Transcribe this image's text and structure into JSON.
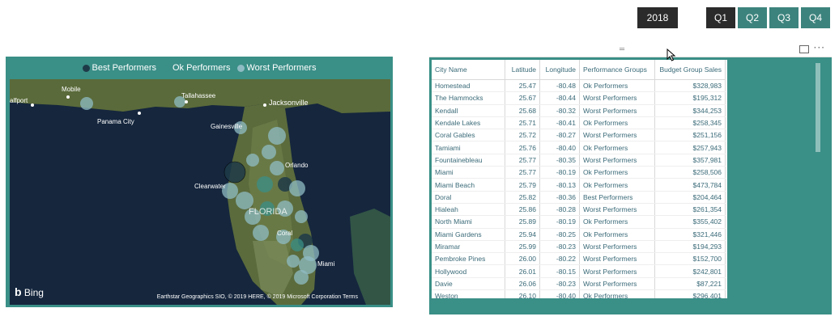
{
  "slicer": {
    "year": "2018",
    "quarters": [
      "Q1",
      "Q2",
      "Q3",
      "Q4"
    ],
    "selected_quarter": "Q1"
  },
  "map": {
    "legend": [
      {
        "label": "Best Performers",
        "color": "#1e3a48"
      },
      {
        "label": "Ok Performers",
        "color": "#3a8f87"
      },
      {
        "label": "Worst Performers",
        "color": "#8fbcc4"
      }
    ],
    "city_labels": [
      "alfport",
      "Mobile",
      "Tallahassee",
      "Jacksonville",
      "Panama City",
      "Gainesville",
      "Clearwater",
      "Orlando",
      "FLORIDA",
      "Coral",
      "Miami"
    ],
    "bing": "Bing",
    "attribution": "Earthstar Geographics SIO, © 2019 HERE, © 2019 Microsoft Corporation",
    "terms": "Terms"
  },
  "table": {
    "columns": [
      "City Name",
      "Latitude",
      "Longitude",
      "Performance Groups",
      "Budget Group Sales"
    ],
    "rows": [
      [
        "Homestead",
        "25.47",
        "-80.48",
        "Ok Performers",
        "$328,983"
      ],
      [
        "The Hammocks",
        "25.67",
        "-80.44",
        "Worst Performers",
        "$195,312"
      ],
      [
        "Kendall",
        "25.68",
        "-80.32",
        "Worst Performers",
        "$344,253"
      ],
      [
        "Kendale Lakes",
        "25.71",
        "-80.41",
        "Ok Performers",
        "$258,345"
      ],
      [
        "Coral Gables",
        "25.72",
        "-80.27",
        "Worst Performers",
        "$251,156"
      ],
      [
        "Tamiami",
        "25.76",
        "-80.40",
        "Ok Performers",
        "$257,943"
      ],
      [
        "Fountainebleau",
        "25.77",
        "-80.35",
        "Worst Performers",
        "$357,981"
      ],
      [
        "Miami",
        "25.77",
        "-80.19",
        "Ok Performers",
        "$258,506"
      ],
      [
        "Miami Beach",
        "25.79",
        "-80.13",
        "Ok Performers",
        "$473,784"
      ],
      [
        "Doral",
        "25.82",
        "-80.36",
        "Best Performers",
        "$204,464"
      ],
      [
        "Hialeah",
        "25.86",
        "-80.28",
        "Worst Performers",
        "$261,354"
      ],
      [
        "North Miami",
        "25.89",
        "-80.19",
        "Ok Performers",
        "$355,402"
      ],
      [
        "Miami Gardens",
        "25.94",
        "-80.25",
        "Ok Performers",
        "$321,446"
      ],
      [
        "Miramar",
        "25.99",
        "-80.23",
        "Worst Performers",
        "$194,293"
      ],
      [
        "Pembroke Pines",
        "26.00",
        "-80.22",
        "Worst Performers",
        "$152,700"
      ],
      [
        "Hollywood",
        "26.01",
        "-80.15",
        "Worst Performers",
        "$242,801"
      ],
      [
        "Davie",
        "26.06",
        "-80.23",
        "Worst Performers",
        "$87,221"
      ],
      [
        "Weston",
        "26.10",
        "-80.40",
        "Ok Performers",
        "$296,401"
      ]
    ]
  },
  "icons": {
    "drag_handle": "drag-handle-icon",
    "focus_mode": "focus-mode-icon",
    "more_options": "more-options-icon",
    "cursor": "cursor-icon"
  }
}
